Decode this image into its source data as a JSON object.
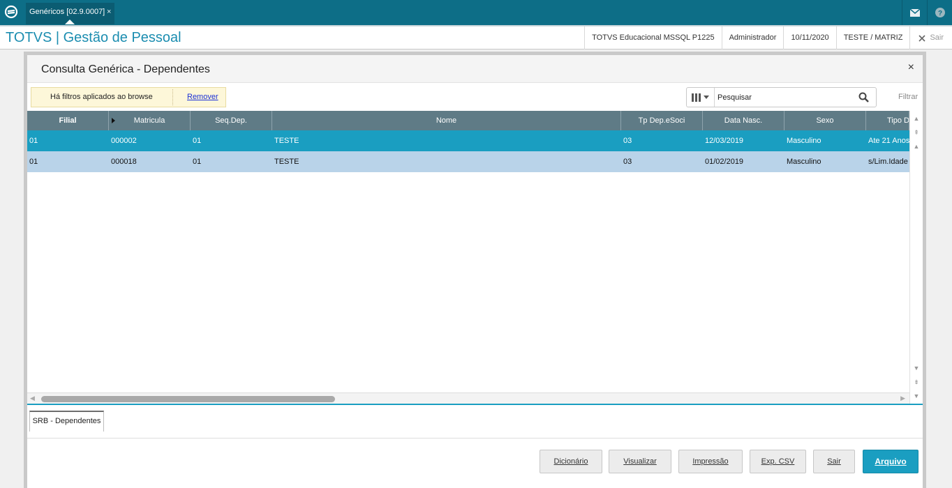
{
  "topbar": {
    "tab_label": "Genéricos [02.9.0007]",
    "tab_close": "×"
  },
  "header": {
    "app_title": "TOTVS | Gestão de Pessoal",
    "environment": "TOTVS Educacional MSSQL P1225",
    "user": "Administrador",
    "date": "10/11/2020",
    "company": "TESTE / MATRIZ",
    "exit_label": "Sair"
  },
  "dialog": {
    "title": "Consulta Genérica - Dependentes",
    "close": "×",
    "filter_notice": "Há filtros aplicados ao browse",
    "filter_remove": "Remover",
    "search_placeholder": "Pesquisar",
    "filter_label": "Filtrar",
    "columns": [
      "Filial",
      "Matricula",
      "Seq.Dep.",
      "Nome",
      "Tp Dep.eSoci",
      "Data Nasc.",
      "Sexo",
      "Tipo D"
    ],
    "rows": [
      [
        "01",
        "000002",
        "01",
        "TESTE",
        "03",
        "12/03/2019",
        "Masculino",
        "Ate 21 Anos"
      ],
      [
        "01",
        "000018",
        "01",
        "TESTE",
        "03",
        "01/02/2019",
        "Masculino",
        "s/Lim.Idade"
      ]
    ],
    "tab_label": "SRB - Dependentes",
    "buttons": {
      "dicionario": "Dicionário",
      "visualizar": "Visualizar",
      "impressao": "Impressão",
      "exp_csv": "Exp. CSV",
      "sair": "Sair",
      "arquivo": "Arquivo"
    }
  },
  "colors": {
    "topbar": "#0d6e87",
    "accent": "#1a9ec1",
    "grid_header": "#5f7b86",
    "row_alt": "#b9d3e9"
  }
}
